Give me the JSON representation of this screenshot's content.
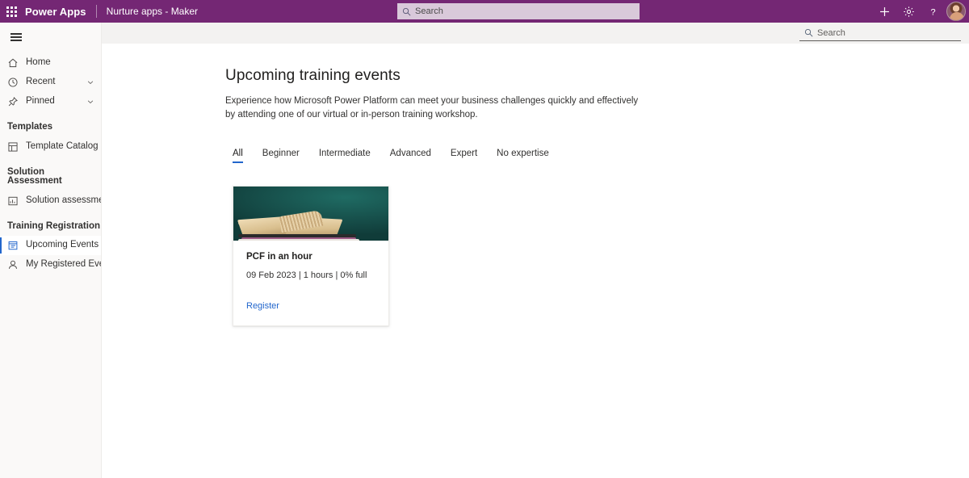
{
  "suitebar": {
    "waffle_label": "app-launcher",
    "brand": "Power Apps",
    "environment": "Nurture apps - Maker",
    "search_placeholder": "Search",
    "search_value": "",
    "actions": [
      {
        "name": "new",
        "glyph": "+"
      },
      {
        "name": "settings",
        "glyph": "gear"
      },
      {
        "name": "help",
        "glyph": "?"
      }
    ],
    "brand_color": "#742774"
  },
  "commandbar": {
    "search_placeholder": "Search",
    "search_value": ""
  },
  "sidebar": {
    "hamburger_label": "Collapse navigation",
    "items": [
      {
        "label": "Home",
        "icon": "home-icon",
        "selected": false,
        "expandable": false
      },
      {
        "label": "Recent",
        "icon": "clock-icon",
        "selected": false,
        "expandable": true
      },
      {
        "label": "Pinned",
        "icon": "pin-icon",
        "selected": false,
        "expandable": true
      }
    ],
    "groups": [
      {
        "title": "Templates",
        "items": [
          {
            "label": "Template Catalog",
            "icon": "template-icon",
            "selected": false
          }
        ]
      },
      {
        "title": "Solution Assessment",
        "items": [
          {
            "label": "Solution assessment",
            "icon": "assessment-icon",
            "selected": false
          }
        ]
      },
      {
        "title": "Training Registration",
        "items": [
          {
            "label": "Upcoming Events",
            "icon": "calendar-list-icon",
            "selected": true
          },
          {
            "label": "My Registered Events",
            "icon": "person-icon",
            "selected": false
          }
        ]
      }
    ],
    "selected_accent": "#2266cc"
  },
  "page": {
    "title": "Upcoming training events",
    "description": "Experience how Microsoft Power Platform can meet your business challenges quickly and effectively by attending one of our virtual or in-person training workshop."
  },
  "tabs": [
    {
      "label": "All",
      "active": true
    },
    {
      "label": "Beginner",
      "active": false
    },
    {
      "label": "Intermediate",
      "active": false
    },
    {
      "label": "Advanced",
      "active": false
    },
    {
      "label": "Expert",
      "active": false
    },
    {
      "label": "No expertise",
      "active": false
    }
  ],
  "cards": [
    {
      "title": "PCF in an hour",
      "meta": "09 Feb 2023 | 1 hours | 0% full",
      "link_label": "Register",
      "image": "open-book-on-teal-background"
    }
  ],
  "colors": {
    "accent": "#2266cc",
    "brand_purple": "#742774",
    "commandbar_bg": "#f3f2f1",
    "sidebar_bg": "#faf9f8"
  }
}
